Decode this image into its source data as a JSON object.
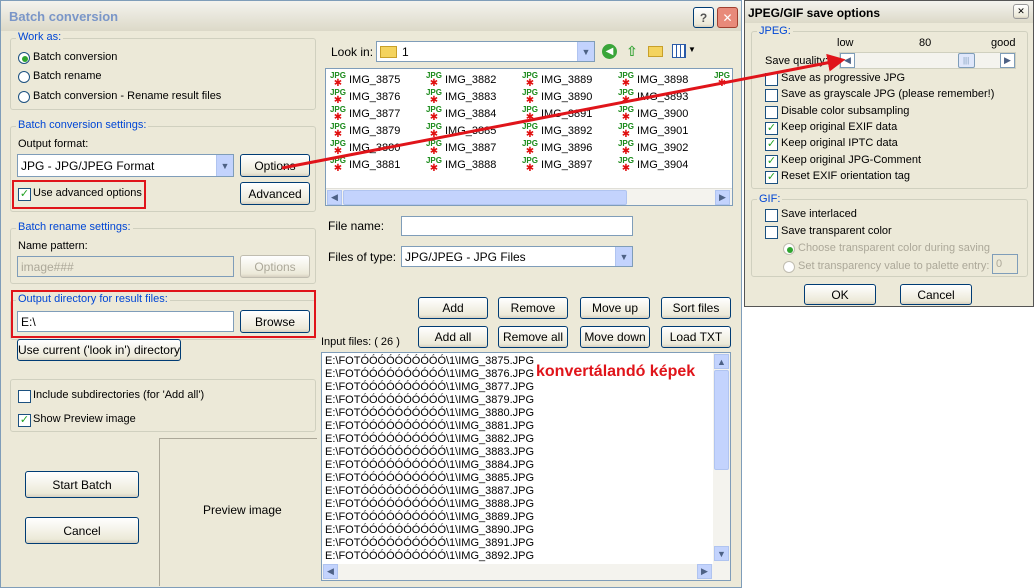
{
  "main": {
    "title": "Batch conversion",
    "work_as": {
      "label": "Work as:",
      "options": [
        "Batch conversion",
        "Batch rename",
        "Batch conversion - Rename result files"
      ]
    },
    "conversion": {
      "label": "Batch conversion settings:",
      "output_format_label": "Output format:",
      "output_format_value": "JPG - JPG/JPEG Format",
      "options_button": "Options",
      "use_advanced_label": "Use advanced options",
      "advanced_button": "Advanced"
    },
    "rename": {
      "label": "Batch rename settings:",
      "name_pattern_label": "Name pattern:",
      "name_pattern_value": "image###",
      "options_button": "Options"
    },
    "output_dir": {
      "label": "Output directory for result files:",
      "value": "E:\\",
      "browse_button": "Browse",
      "use_current_button": "Use current ('look in') directory"
    },
    "include_subdirs_label": "Include subdirectories (for 'Add all')",
    "show_preview_label": "Show Preview image",
    "start_button": "Start Batch",
    "cancel_button": "Cancel",
    "preview_label": "Preview image",
    "look_in_label": "Look in:",
    "look_in_value": "1",
    "files": [
      [
        "IMG_3875",
        "IMG_3876",
        "IMG_3877",
        "IMG_3879",
        "IMG_3880",
        "IMG_3881"
      ],
      [
        "IMG_3882",
        "IMG_3883",
        "IMG_3884",
        "IMG_3885",
        "IMG_3887",
        "IMG_3888"
      ],
      [
        "IMG_3889",
        "IMG_3890",
        "IMG_3891",
        "IMG_3892",
        "IMG_3896",
        "IMG_3897"
      ],
      [
        "IMG_3898",
        "IMG_3893",
        "IMG_3900",
        "IMG_3901",
        "IMG_3902",
        "IMG_3904"
      ],
      [
        "I"
      ]
    ],
    "thumb_tag": "JPG",
    "file_name_label": "File name:",
    "file_name_value": "",
    "files_of_type_label": "Files of type:",
    "files_of_type_value": "JPG/JPEG - JPG Files",
    "buttons_row1": [
      "Add",
      "Remove",
      "Move up",
      "Sort files"
    ],
    "buttons_row2": [
      "Add all",
      "Remove all",
      "Move down",
      "Load TXT"
    ],
    "input_files_label": "Input files: ( 26 )",
    "annotation": "konvertálandó képek",
    "input_files": [
      "E:\\FOTÓÓÓÓÓÓÓÓÓÓ\\1\\IMG_3875.JPG",
      "E:\\FOTÓÓÓÓÓÓÓÓÓÓ\\1\\IMG_3876.JPG",
      "E:\\FOTÓÓÓÓÓÓÓÓÓÓ\\1\\IMG_3877.JPG",
      "E:\\FOTÓÓÓÓÓÓÓÓÓÓ\\1\\IMG_3879.JPG",
      "E:\\FOTÓÓÓÓÓÓÓÓÓÓ\\1\\IMG_3880.JPG",
      "E:\\FOTÓÓÓÓÓÓÓÓÓÓ\\1\\IMG_3881.JPG",
      "E:\\FOTÓÓÓÓÓÓÓÓÓÓ\\1\\IMG_3882.JPG",
      "E:\\FOTÓÓÓÓÓÓÓÓÓÓ\\1\\IMG_3883.JPG",
      "E:\\FOTÓÓÓÓÓÓÓÓÓÓ\\1\\IMG_3884.JPG",
      "E:\\FOTÓÓÓÓÓÓÓÓÓÓ\\1\\IMG_3885.JPG",
      "E:\\FOTÓÓÓÓÓÓÓÓÓÓ\\1\\IMG_3887.JPG",
      "E:\\FOTÓÓÓÓÓÓÓÓÓÓ\\1\\IMG_3888.JPG",
      "E:\\FOTÓÓÓÓÓÓÓÓÓÓ\\1\\IMG_3889.JPG",
      "E:\\FOTÓÓÓÓÓÓÓÓÓÓ\\1\\IMG_3890.JPG",
      "E:\\FOTÓÓÓÓÓÓÓÓÓÓ\\1\\IMG_3891.JPG",
      "E:\\FOTÓÓÓÓÓÓÓÓÓÓ\\1\\IMG_3892.JPG"
    ]
  },
  "dialog": {
    "title": "JPEG/GIF save options",
    "jpeg_group": "JPEG:",
    "quality_low": "low",
    "quality_value": "80",
    "quality_high": "good",
    "quality_label": "Save quality:",
    "quality_fraction": 0.8,
    "jpeg_options": [
      {
        "label": "Save as progressive JPG",
        "checked": false
      },
      {
        "label": "Save as grayscale JPG (please remember!)",
        "checked": false
      },
      {
        "label": "Disable color subsampling",
        "checked": false
      },
      {
        "label": "Keep original EXIF data",
        "checked": true
      },
      {
        "label": "Keep original IPTC data",
        "checked": true
      },
      {
        "label": "Keep original JPG-Comment",
        "checked": true
      },
      {
        "label": "Reset EXIF orientation tag",
        "checked": true
      }
    ],
    "gif_group": "GIF:",
    "save_interlaced": "Save interlaced",
    "save_transparent": "Save transparent color",
    "choose_transparent": "Choose transparent color during saving",
    "set_transparency": "Set transparency value to palette entry:",
    "palette_entry": "0",
    "ok_button": "OK",
    "cancel_button": "Cancel"
  },
  "colors": {
    "accent": "#0046d5",
    "highlight_red": "#e0141a",
    "window_bg": "#ece9d8"
  }
}
